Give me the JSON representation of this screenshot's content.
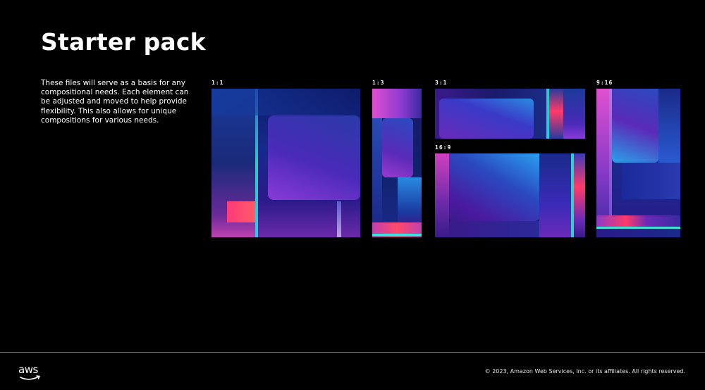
{
  "slide": {
    "title": "Starter pack",
    "description": "These files will serve as a basis for any compositional needs. Each element can be adjusted and moved to help provide flexibility. This also allows for unique compositions for various needs."
  },
  "panels": [
    {
      "label": "1:1"
    },
    {
      "label": "1:3"
    },
    {
      "label": "3:1"
    },
    {
      "label": "16:9"
    },
    {
      "label": "9:16"
    }
  ],
  "footer": {
    "logo_text": "aws",
    "copyright": "© 2023, Amazon Web Services, Inc. or its affiliates. All rights reserved."
  },
  "colors": {
    "background": "#000000",
    "navy": "#0a0b3a",
    "blue": "#1f5bd6",
    "violet": "#8a2be2",
    "pink": "#e040c8",
    "red": "#ff3a5c",
    "cyan": "#20d0e0"
  },
  "icons": [
    "aws-logo-icon"
  ]
}
